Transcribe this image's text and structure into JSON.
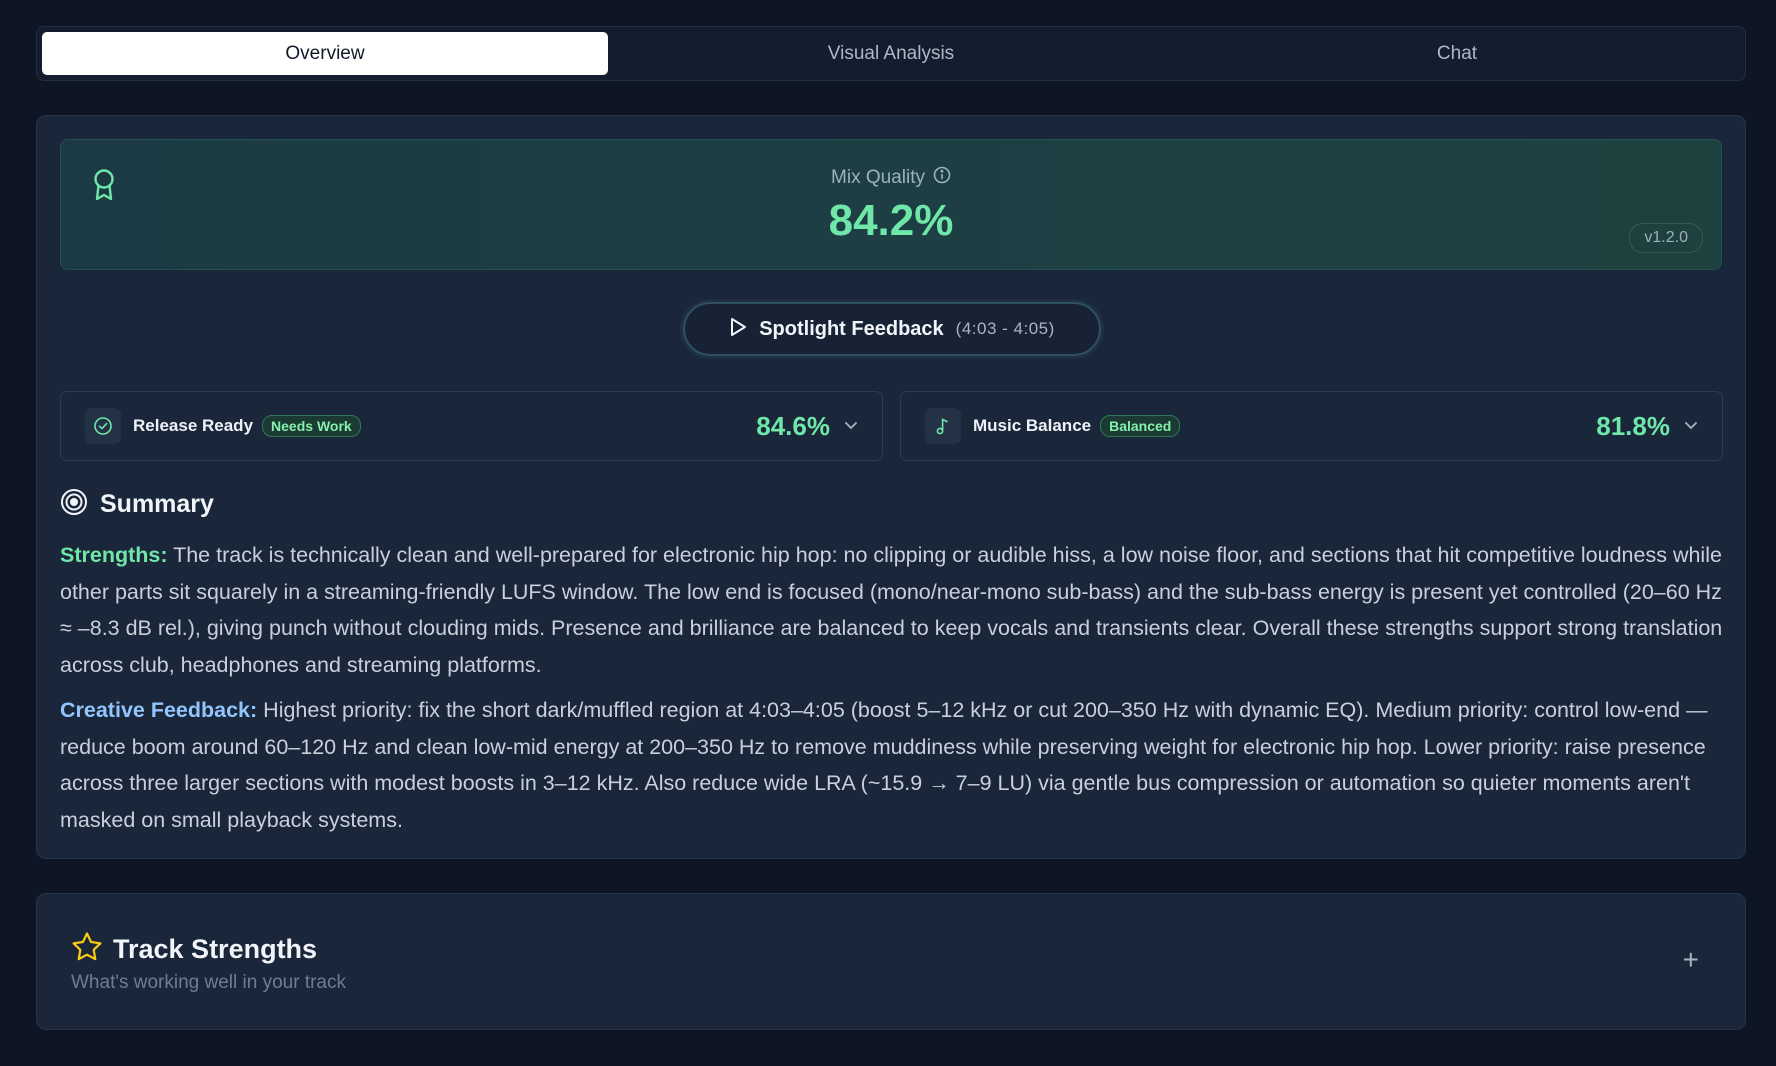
{
  "tabs": [
    {
      "label": "Overview",
      "active": true
    },
    {
      "label": "Visual Analysis",
      "active": false
    },
    {
      "label": "Chat",
      "active": false
    }
  ],
  "quality": {
    "label": "Mix Quality",
    "value": "84.2%",
    "version": "v1.2.0",
    "icon": "award-icon",
    "info_icon": "info-icon"
  },
  "spotlight": {
    "label": "Spotlight Feedback",
    "time_range": "(4:03 - 4:05)",
    "icon": "play-icon"
  },
  "metrics": [
    {
      "title": "Release Ready",
      "badge": "Needs Work",
      "value": "84.6%",
      "icon": "check-circle-icon"
    },
    {
      "title": "Music Balance",
      "badge": "Balanced",
      "value": "81.8%",
      "icon": "music-note-icon"
    }
  ],
  "summary": {
    "title": "Summary",
    "icon": "target-icon",
    "strengths_label": "Strengths:",
    "strengths_text": " The track is technically clean and well-prepared for electronic hip hop: no clipping or audible hiss, a low noise floor, and sections that hit competitive loudness while other parts sit squarely in a streaming-friendly LUFS window. The low end is focused (mono/near-mono sub-bass) and the sub-bass energy is present yet controlled (20–60 Hz ≈ –8.3 dB rel.), giving punch without clouding mids. Presence and brilliance are balanced to keep vocals and transients clear. Overall these strengths support strong translation across club, headphones and streaming platforms.",
    "creative_label": "Creative Feedback:",
    "creative_text": " Highest priority: fix the short dark/muffled region at 4:03–4:05 (boost 5–12 kHz or cut 200–350 Hz with dynamic EQ). Medium priority: control low-end — reduce boom around 60–120 Hz and clean low-mid energy at 200–350 Hz to remove muddiness while preserving weight for electronic hip hop. Lower priority: raise presence across three larger sections with modest boosts in 3–12 kHz. Also reduce wide LRA (~15.9 → 7–9 LU) via gentle bus compression or automation so quieter moments aren't masked on small playback systems."
  },
  "track_strengths": {
    "title": "Track Strengths",
    "subtitle": "What's working well in your track",
    "icon": "star-icon",
    "expand_symbol": "+"
  },
  "colors": {
    "accent_green": "#6ee7a8",
    "accent_blue": "#93c5fd",
    "star_yellow": "#facc15"
  }
}
